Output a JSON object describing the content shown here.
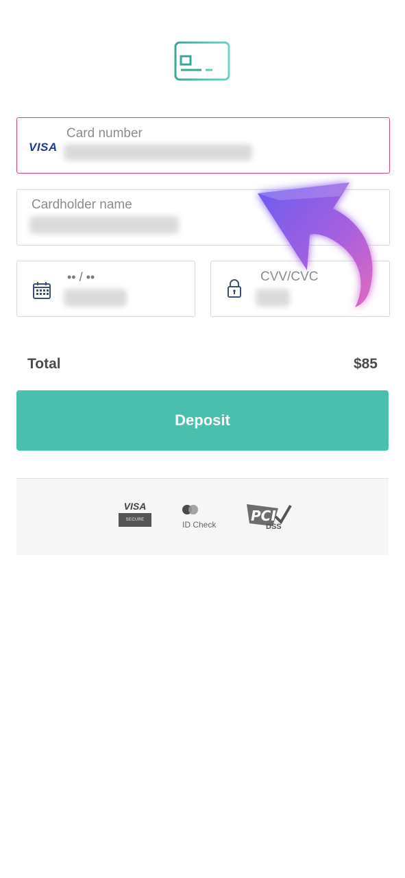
{
  "form": {
    "card_number": {
      "label": "Card number",
      "brand": "VISA"
    },
    "cardholder": {
      "label": "Cardholder name"
    },
    "expiry": {
      "placeholder": "•• / ••"
    },
    "cvv": {
      "label": "CVV/CVC"
    }
  },
  "summary": {
    "total_label": "Total",
    "total_amount": "$85"
  },
  "actions": {
    "deposit_label": "Deposit"
  },
  "badges": {
    "visa_secure_top": "VISA",
    "visa_secure_bottom": "SECURE",
    "id_check": "ID Check",
    "pci_dss": "DSS"
  },
  "colors": {
    "accent": "#4bbfad",
    "error_border": "#e0446f",
    "arrow_start": "#6b5cf0",
    "arrow_end": "#e06ac0"
  },
  "icons": [
    "credit-card-icon",
    "calendar-icon",
    "lock-icon",
    "pointer-arrow"
  ]
}
